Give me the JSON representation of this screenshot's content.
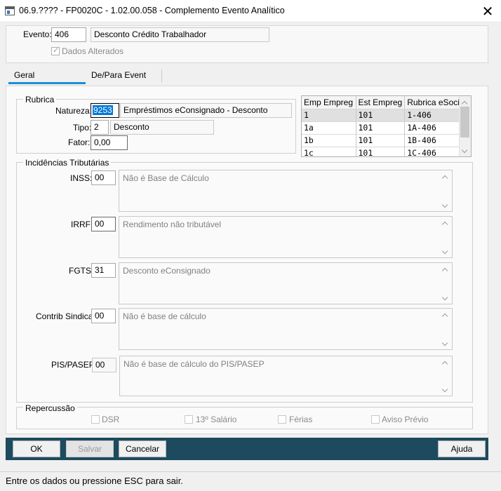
{
  "window": {
    "title": "06.9.???? - FP0020C - 1.02.00.058 - Complemento Evento Analítico",
    "close_glyph": "✕"
  },
  "header": {
    "evento_label": "Evento:",
    "evento_code": "406",
    "evento_desc": "Desconto Crédito Trabalhador",
    "dados_alterados_label": "Dados Alterados",
    "dados_alterados_checked": true
  },
  "tabs": [
    {
      "label": "Geral",
      "active": true
    },
    {
      "label": "De/Para Event",
      "active": false
    }
  ],
  "rubrica": {
    "group_title": "Rubrica",
    "natureza_label": "Natureza:",
    "natureza_code": "9253",
    "natureza_desc": "Empréstimos eConsignado - Desconto",
    "tipo_label": "Tipo:",
    "tipo_code": "2",
    "tipo_desc": "Desconto",
    "fator_label": "Fator:",
    "fator_value": "0,00"
  },
  "grid": {
    "columns": [
      "Emp Empreg",
      "Est Empreg",
      "Rubrica eSocial"
    ],
    "rows": [
      [
        "1",
        "101",
        "1-406"
      ],
      [
        "1a",
        "101",
        "1A-406"
      ],
      [
        "1b",
        "101",
        "1B-406"
      ],
      [
        "1c",
        "101",
        "1C-406"
      ]
    ],
    "selected_row": 0
  },
  "incidencias": {
    "group_title": "Incidências Tributárias",
    "items": [
      {
        "label": "INSS:",
        "code": "00",
        "desc": "Não é Base de Cálculo"
      },
      {
        "label": "IRRF:",
        "code": "00",
        "desc": "Rendimento não tributável"
      },
      {
        "label": "FGTS:",
        "code": "31",
        "desc": "Desconto eConsignado"
      },
      {
        "label": "Contrib Sindical:",
        "code": "00",
        "desc": "Não é base de cálculo"
      },
      {
        "label": "PIS/PASEP:",
        "code": "00",
        "desc": "Não é base de cálculo do PIS/PASEP"
      }
    ]
  },
  "repercussao": {
    "group_title": "Repercussão",
    "options": [
      {
        "label": "DSR",
        "checked": false
      },
      {
        "label": "13º Salário",
        "checked": false
      },
      {
        "label": "Férias",
        "checked": false
      },
      {
        "label": "Aviso Prévio",
        "checked": false
      }
    ]
  },
  "buttons": {
    "ok": "OK",
    "salvar": "Salvar",
    "cancelar": "Cancelar",
    "ajuda": "Ajuda"
  },
  "status_bar": {
    "text": "Entre os dados ou pressione ESC para sair."
  },
  "colors": {
    "button_bar": "#1d4a5e",
    "tab_accent": "#1a8fd8",
    "selection": "#0078d7"
  }
}
